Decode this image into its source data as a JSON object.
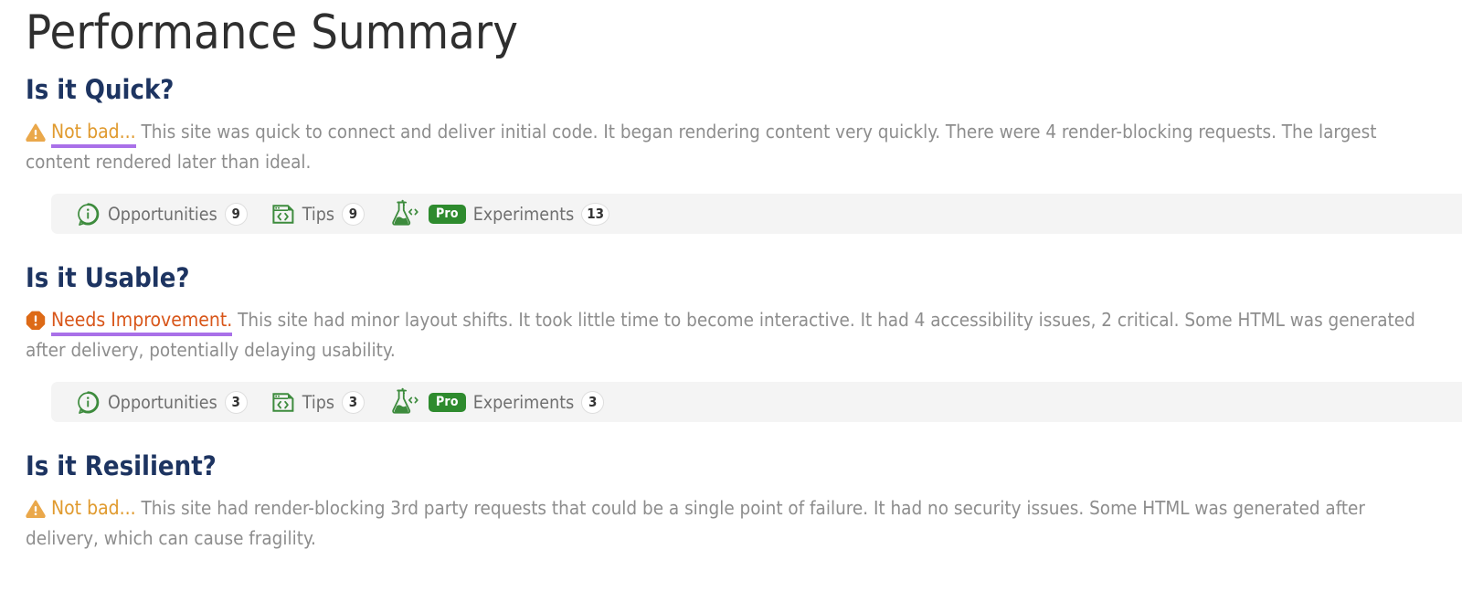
{
  "page": {
    "title": "Performance Summary"
  },
  "colors": {
    "heading": "#1d3461",
    "body_text": "#8d8d8d",
    "warn": "#e09a2e",
    "alert": "#d8561a",
    "underline": "#a970e8",
    "icon_green": "#3d8b3d",
    "pro_badge_bg": "#2e8b2e",
    "strip_bg": "#f4f4f4",
    "title": "#2f2f2f"
  },
  "sections": [
    {
      "heading": "Is it Quick?",
      "status_icon": "warning-triangle-icon",
      "status_style": "warn",
      "underlined": true,
      "verdict": "Not bad...",
      "description": "This site was quick to connect and deliver initial code. It began rendering content very quickly. There were 4 render-blocking requests. The largest content rendered later than ideal.",
      "badges": [
        {
          "icon": "info-bubble-icon",
          "label": "Opportunities",
          "count": "9"
        },
        {
          "icon": "code-window-icon",
          "label": "Tips",
          "count": "9"
        },
        {
          "icon": "flask-code-icon",
          "pro": "Pro",
          "label": "Experiments",
          "count": "13"
        }
      ]
    },
    {
      "heading": "Is it Usable?",
      "status_icon": "alert-octagon-icon",
      "status_style": "alert",
      "underlined": true,
      "verdict": "Needs Improvement.",
      "description": "This site had minor layout shifts. It took little time to become interactive. It had 4 accessibility issues, 2 critical. Some HTML was generated after delivery, potentially delaying usability.",
      "badges": [
        {
          "icon": "info-bubble-icon",
          "label": "Opportunities",
          "count": "3"
        },
        {
          "icon": "code-window-icon",
          "label": "Tips",
          "count": "3"
        },
        {
          "icon": "flask-code-icon",
          "pro": "Pro",
          "label": "Experiments",
          "count": "3"
        }
      ]
    },
    {
      "heading": "Is it Resilient?",
      "status_icon": "warning-triangle-icon",
      "status_style": "warn",
      "underlined": false,
      "verdict": "Not bad...",
      "description": "This site had render-blocking 3rd party requests that could be a single point of failure. It had no security issues. Some HTML was generated after delivery, which can cause fragility.",
      "badges": []
    }
  ]
}
